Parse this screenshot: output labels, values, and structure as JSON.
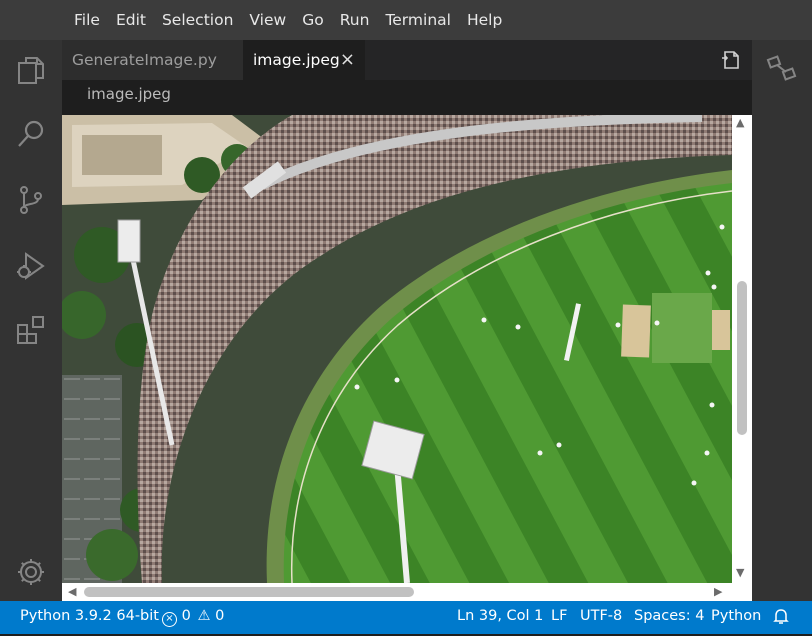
{
  "menu": [
    "File",
    "Edit",
    "Selection",
    "View",
    "Go",
    "Run",
    "Terminal",
    "Help"
  ],
  "tabs": {
    "inactive": "GenerateImage.py",
    "active": "image.jpeg",
    "close_glyph": "×"
  },
  "breadcrumb": "image.jpeg",
  "image": {
    "subject": "aerial view of cricket stadium",
    "colors": {
      "grass_light": "#4f9a33",
      "grass_dark": "#3c8426",
      "pitch": "#d8c59a",
      "crowd": "#9c8a82"
    }
  },
  "status": {
    "python": "Python 3.9.2 64-bit",
    "errors": "0",
    "warnings": "0",
    "position": "Ln 39, Col 1",
    "eol": "LF",
    "encoding": "UTF-8",
    "spaces": "Spaces: 4",
    "language": "Python"
  },
  "colors": {
    "statusbar": "#007acc",
    "activitybar": "#333333",
    "menubar": "#3c3c3c"
  }
}
